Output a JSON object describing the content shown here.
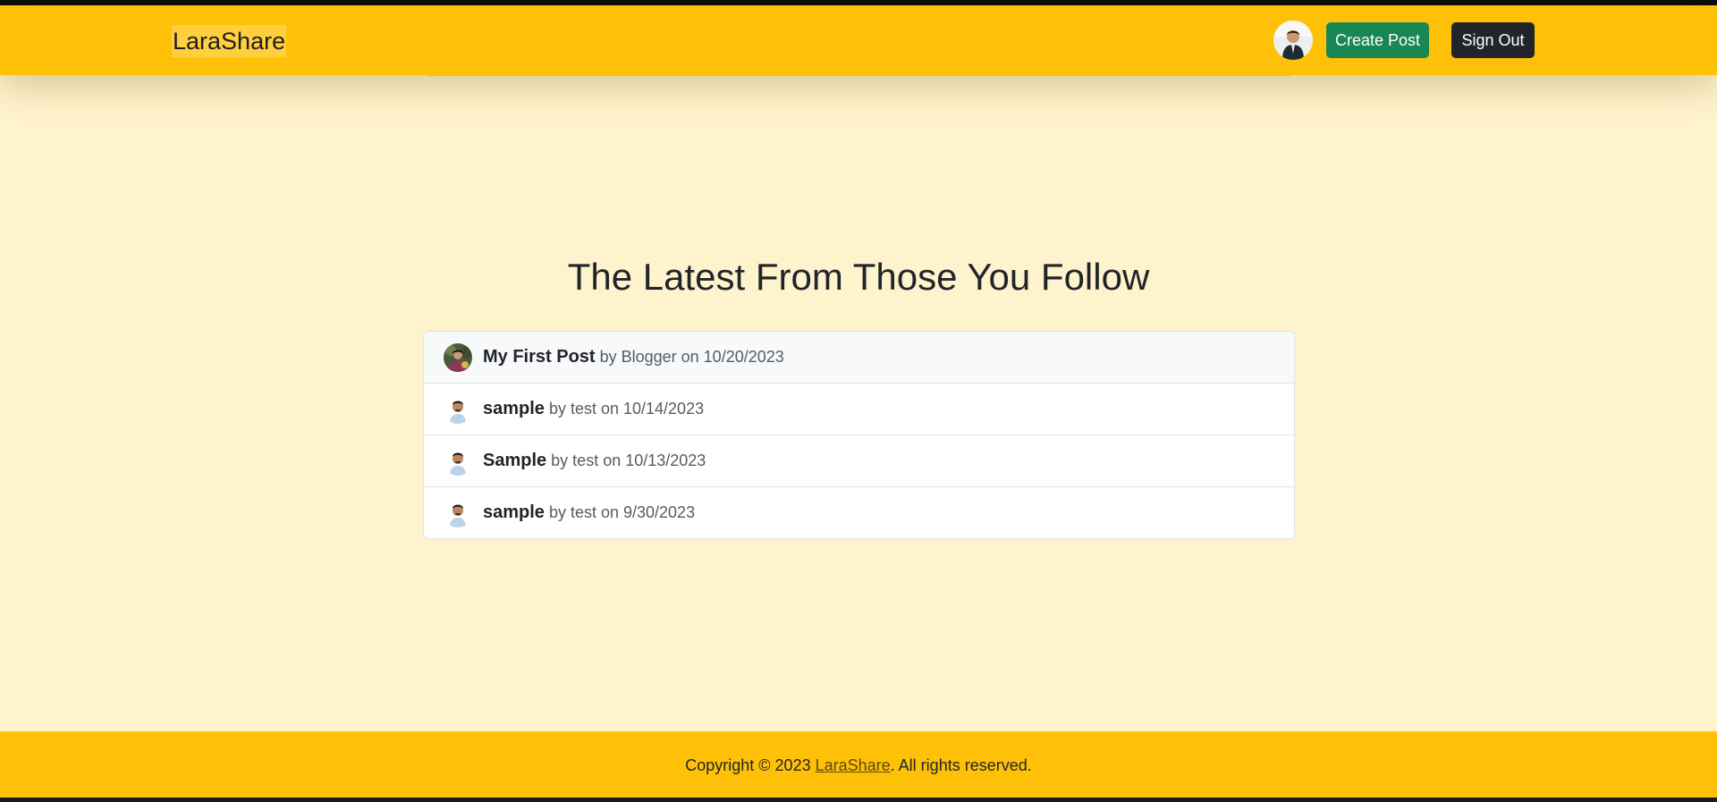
{
  "header": {
    "brand": "LaraShare",
    "avatar_icon": "user-avatar-icon",
    "create_label": "Create Post",
    "signout_label": "Sign Out"
  },
  "main": {
    "title": "The Latest From Those You Follow",
    "posts": [
      {
        "title": "My First Post",
        "meta": "by Blogger on 10/20/2023",
        "avatar_icon": "blogger-avatar-icon"
      },
      {
        "title": "sample",
        "meta": "by test on 10/14/2023",
        "avatar_icon": "test-avatar-icon"
      },
      {
        "title": "Sample",
        "meta": "by test on 10/13/2023",
        "avatar_icon": "test-avatar-icon"
      },
      {
        "title": "sample",
        "meta": "by test on 9/30/2023",
        "avatar_icon": "test-avatar-icon"
      }
    ]
  },
  "footer": {
    "prefix": "Copyright © 2023 ",
    "link": "LaraShare",
    "suffix": ". All rights reserved."
  },
  "colors": {
    "header_bg": "#ffc107",
    "main_bg": "#fff3cd",
    "create_button": "#198754",
    "signout_button": "#212529"
  }
}
